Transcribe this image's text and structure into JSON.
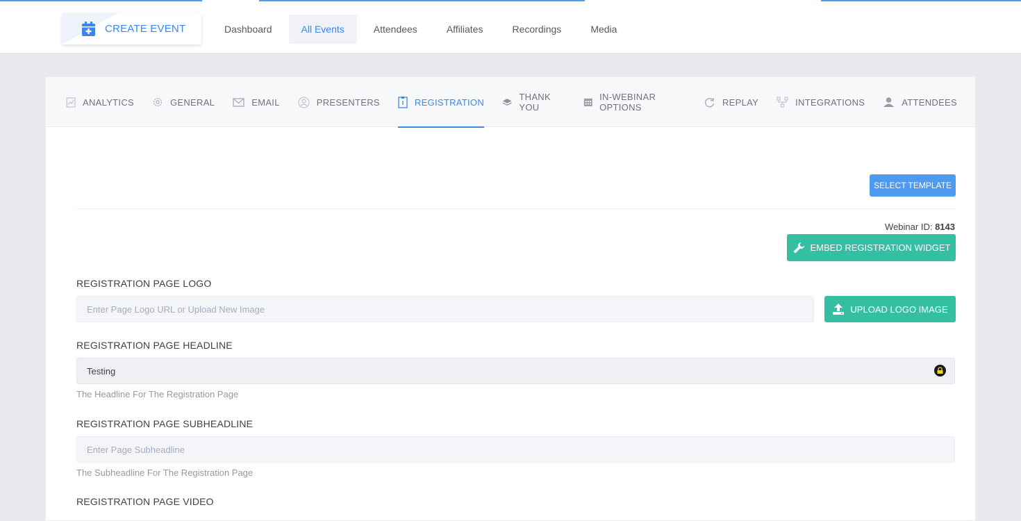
{
  "header": {
    "create_event_label": "CREATE EVENT",
    "nav": [
      {
        "label": "Dashboard"
      },
      {
        "label": "All Events"
      },
      {
        "label": "Attendees"
      },
      {
        "label": "Affiliates"
      },
      {
        "label": "Recordings"
      },
      {
        "label": "Media"
      }
    ],
    "active_nav": "All Events"
  },
  "tabs": [
    {
      "label": "ANALYTICS",
      "icon": "chart-icon"
    },
    {
      "label": "GENERAL",
      "icon": "gear-icon"
    },
    {
      "label": "EMAIL",
      "icon": "envelope-icon"
    },
    {
      "label": "PRESENTERS",
      "icon": "user-circle-icon"
    },
    {
      "label": "REGISTRATION",
      "icon": "form-icon"
    },
    {
      "label": "THANK YOU",
      "icon": "layers-icon"
    },
    {
      "label": "IN-WEBINAR OPTIONS",
      "icon": "calendar-grid-icon"
    },
    {
      "label": "REPLAY",
      "icon": "refresh-icon"
    },
    {
      "label": "INTEGRATIONS",
      "icon": "network-icon"
    },
    {
      "label": "ATTENDEES",
      "icon": "person-icon"
    }
  ],
  "active_tab": "REGISTRATION",
  "main": {
    "select_template_label": "SELECT TEMPLATE",
    "webinar_id_label": "Webinar ID:",
    "webinar_id_value": "8143",
    "embed_widget_label": "EMBED REGISTRATION WIDGET",
    "logo": {
      "label": "REGISTRATION PAGE LOGO",
      "placeholder": "Enter Page Logo URL or Upload New Image",
      "value": "",
      "upload_label": "UPLOAD LOGO IMAGE"
    },
    "headline": {
      "label": "REGISTRATION PAGE HEADLINE",
      "value": "Testing",
      "help": "The Headline For The Registration Page"
    },
    "subheadline": {
      "label": "REGISTRATION PAGE SUBHEADLINE",
      "placeholder": "Enter Page Subheadline",
      "value": "",
      "help": "The Subheadline For The Registration Page"
    },
    "video": {
      "label": "REGISTRATION PAGE VIDEO"
    }
  },
  "colors": {
    "accent_blue": "#3a86ea",
    "primary_button": "#4e9af1",
    "success_teal": "#34bfa3"
  }
}
